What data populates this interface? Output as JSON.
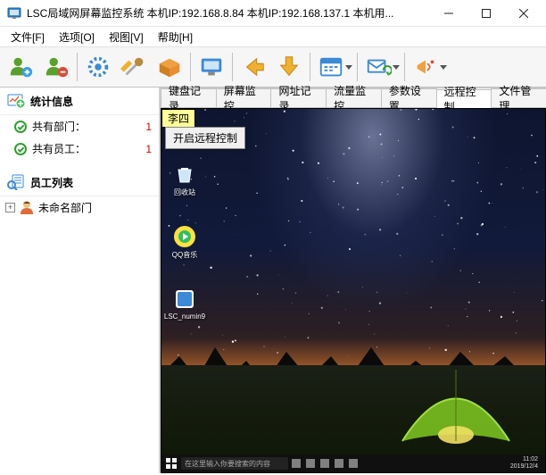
{
  "window": {
    "title": "LSC局域网屏幕监控系统    本机IP:192.168.8.84   本机IP:192.168.137.1    本机用..."
  },
  "menu": {
    "file": "文件[F]",
    "options": "选项[O]",
    "view": "视图[V]",
    "help": "帮助[H]"
  },
  "sidebar": {
    "stats_header": "统计信息",
    "dept_label": "共有部门：",
    "dept_count": "1",
    "emp_label": "共有员工：",
    "emp_count": "1",
    "list_header": "员工列表",
    "unnamed_dept": "未命名部门"
  },
  "tabs": {
    "keyboard": "键盘记录",
    "screen": "屏幕监控",
    "url": "网址记录",
    "traffic": "流量监控",
    "settings": "参数设置",
    "remote": "远程控制",
    "files": "文件管理"
  },
  "content": {
    "client_name": "李四",
    "context_button": "开启远程控制"
  },
  "remote": {
    "search_placeholder": "在这里输入你要搜索的内容",
    "clock_time": "11:02",
    "clock_date": "2019/12/4",
    "desk": {
      "recycle": "回收站",
      "qqmusic": "QQ音乐",
      "lsc": "LSC_numin9"
    }
  }
}
